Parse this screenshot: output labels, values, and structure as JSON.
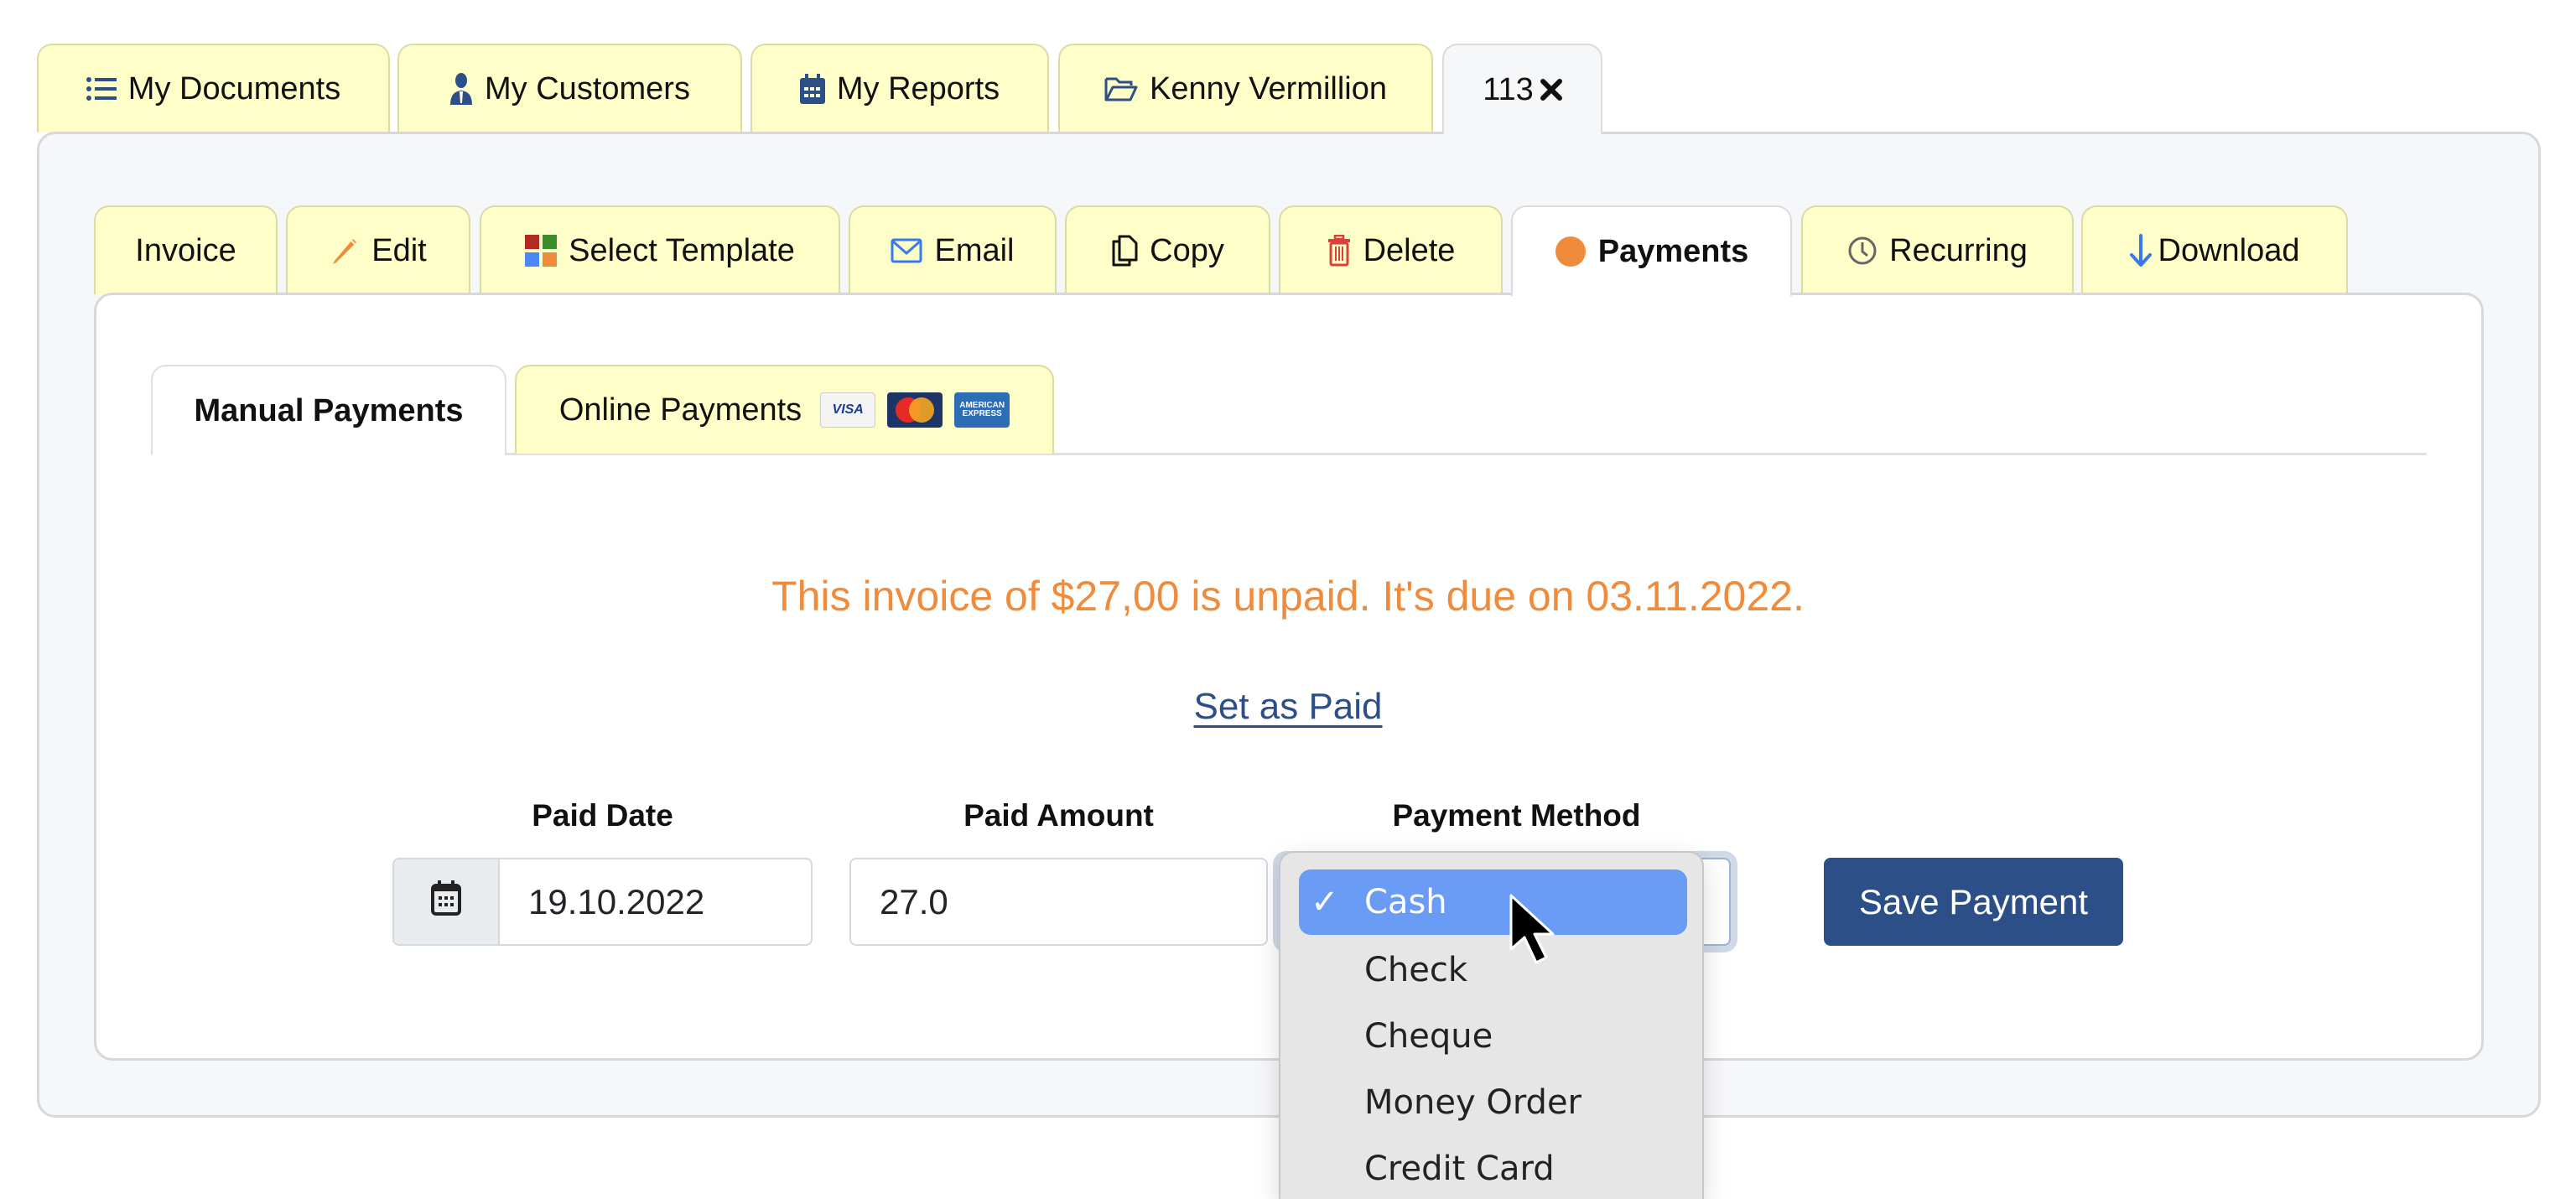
{
  "top_tabs": [
    {
      "label": "My Documents",
      "icon": "list-icon",
      "active": false
    },
    {
      "label": "My Customers",
      "icon": "user-tie-icon",
      "active": false
    },
    {
      "label": "My Reports",
      "icon": "calendar-icon",
      "active": false
    },
    {
      "label": "Kenny Vermillion",
      "icon": "folder-open-icon",
      "active": false
    },
    {
      "label": "113",
      "icon": "close-icon",
      "active": true
    }
  ],
  "doc_tabs": [
    {
      "label": "Invoice",
      "icon": null
    },
    {
      "label": "Edit",
      "icon": "pencil-icon"
    },
    {
      "label": "Select Template",
      "icon": "template-grid-icon"
    },
    {
      "label": "Email",
      "icon": "envelope-icon"
    },
    {
      "label": "Copy",
      "icon": "copy-icon"
    },
    {
      "label": "Delete",
      "icon": "trash-icon"
    },
    {
      "label": "Payments",
      "icon": "status-dot-icon",
      "active": true
    },
    {
      "label": "Recurring",
      "icon": "clock-icon"
    },
    {
      "label": "Download",
      "icon": "arrow-down-icon"
    }
  ],
  "payment_tabs": [
    {
      "label": "Manual Payments",
      "active": true
    },
    {
      "label": "Online Payments",
      "active": false,
      "card_logos": [
        "VISA",
        "MasterCard",
        "American Express"
      ]
    }
  ],
  "status": {
    "message": "This invoice of $27,00 is unpaid. It's due on 03.11.2022.",
    "color": "#ef8b3a"
  },
  "set_paid_link": "Set as Paid",
  "form": {
    "paid_date": {
      "label": "Paid Date",
      "value": "19.10.2022"
    },
    "paid_amount": {
      "label": "Paid Amount",
      "value": "27.0"
    },
    "payment_method": {
      "label": "Payment Method",
      "selected": "Cash",
      "options": [
        "Cash",
        "Check",
        "Cheque",
        "Money Order",
        "Credit Card"
      ]
    },
    "save_label": "Save Payment"
  },
  "colors": {
    "tab_bg": "#fefec8",
    "primary": "#2d4f87",
    "accent_orange": "#ef8b3a",
    "dropdown_highlight": "#6a9cf6"
  }
}
